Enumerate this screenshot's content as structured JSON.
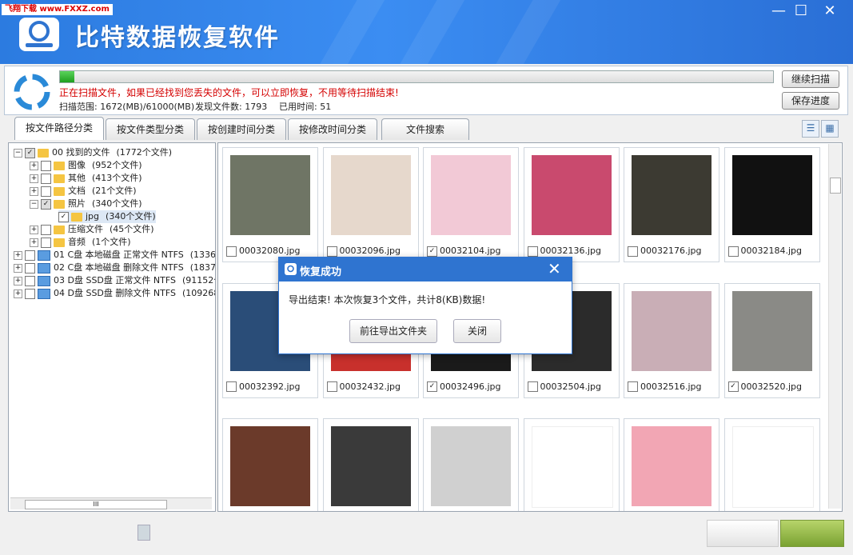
{
  "watermark": "飞翔下载 www.FXXZ.com",
  "app": {
    "title": "比特数据恢复软件"
  },
  "window_controls": {
    "minimize": "—",
    "maximize": "☐",
    "close": "✕"
  },
  "scan": {
    "progress": 0.02,
    "message": "正在扫描文件，如果已经找到您丢失的文件，可以立即恢复，不用等待扫描结束!",
    "range": "扫描范围: 1672(MB)/61000(MB)",
    "found": "发现文件数: 1793",
    "elapsed": "已用时间: 51",
    "continue_label": "继续扫描",
    "save_label": "保存进度"
  },
  "tabs": [
    {
      "label": "按文件路径分类"
    },
    {
      "label": "按文件类型分类"
    },
    {
      "label": "按创建时间分类"
    },
    {
      "label": "按修改时间分类"
    },
    {
      "label": "文件搜索"
    }
  ],
  "tree": [
    {
      "exp": "⊟",
      "cb": "half",
      "icon": "folder",
      "label": "00 找到的文件",
      "count": "(1772个文件)"
    },
    {
      "exp": "⊞",
      "cb": "",
      "icon": "folder",
      "label": "图像",
      "count": "(952个文件)"
    },
    {
      "exp": "⊞",
      "cb": "",
      "icon": "folder",
      "label": "其他",
      "count": "(413个文件)"
    },
    {
      "exp": "⊞",
      "cb": "",
      "icon": "folder",
      "label": "文档",
      "count": "(21个文件)"
    },
    {
      "exp": "⊟",
      "cb": "half",
      "icon": "folder",
      "label": "照片",
      "count": "(340个文件)"
    },
    {
      "exp": "",
      "cb": "check",
      "icon": "folder",
      "label": "jpg",
      "count": "(340个文件)"
    },
    {
      "exp": "⊞",
      "cb": "",
      "icon": "folder",
      "label": "压缩文件",
      "count": "(45个文件)"
    },
    {
      "exp": "⊞",
      "cb": "",
      "icon": "folder",
      "label": "音频",
      "count": "(1个文件)"
    },
    {
      "exp": "⊞",
      "cb": "",
      "icon": "drive",
      "label": "01 C盘 本地磁盘 正常文件 NTFS",
      "count": "(1336"
    },
    {
      "exp": "⊞",
      "cb": "",
      "icon": "drive",
      "label": "02 C盘 本地磁盘 删除文件 NTFS",
      "count": "(1837"
    },
    {
      "exp": "⊞",
      "cb": "",
      "icon": "drive",
      "label": "03 D盘 SSD盘 正常文件 NTFS",
      "count": "(91152个"
    },
    {
      "exp": "⊞",
      "cb": "",
      "icon": "drive",
      "label": "04 D盘 SSD盘 删除文件 NTFS",
      "count": "(109268"
    }
  ],
  "tree_scroll_label": "III",
  "files": [
    {
      "name": "00032080.jpg",
      "checked": false,
      "color": "#6f7565"
    },
    {
      "name": "00032096.jpg",
      "checked": false,
      "color": "#e6d8cc"
    },
    {
      "name": "00032104.jpg",
      "checked": true,
      "color": "#f2c9d6"
    },
    {
      "name": "00032136.jpg",
      "checked": false,
      "color": "#c94a6e"
    },
    {
      "name": "00032176.jpg",
      "checked": false,
      "color": "#3c3a32"
    },
    {
      "name": "00032184.jpg",
      "checked": false,
      "color": "#111111"
    },
    {
      "name": "00032392.jpg",
      "checked": false,
      "color": "#2a4d78"
    },
    {
      "name": "00032432.jpg",
      "checked": false,
      "color": "#c8302c"
    },
    {
      "name": "00032496.jpg",
      "checked": true,
      "color": "#1a1a1a"
    },
    {
      "name": "00032504.jpg",
      "checked": false,
      "color": "#2b2b2b"
    },
    {
      "name": "00032516.jpg",
      "checked": false,
      "color": "#c9aeb6"
    },
    {
      "name": "00032520.jpg",
      "checked": true,
      "color": "#8a8a86"
    },
    {
      "name": "",
      "checked": false,
      "color": "#6b3a2a"
    },
    {
      "name": "",
      "checked": false,
      "color": "#3a3a3a"
    },
    {
      "name": "",
      "checked": false,
      "color": "#d0d0d0"
    },
    {
      "name": "",
      "checked": false,
      "color": "#ffffff"
    },
    {
      "name": "",
      "checked": false,
      "color": "#f2a6b4"
    },
    {
      "name": "",
      "checked": false,
      "color": "#ffffff"
    }
  ],
  "dialog": {
    "title": "恢复成功",
    "message": "导出结束! 本次恢复3个文件，共计8(KB)数据!",
    "open_folder_label": "前往导出文件夹",
    "close_label": "关闭"
  }
}
